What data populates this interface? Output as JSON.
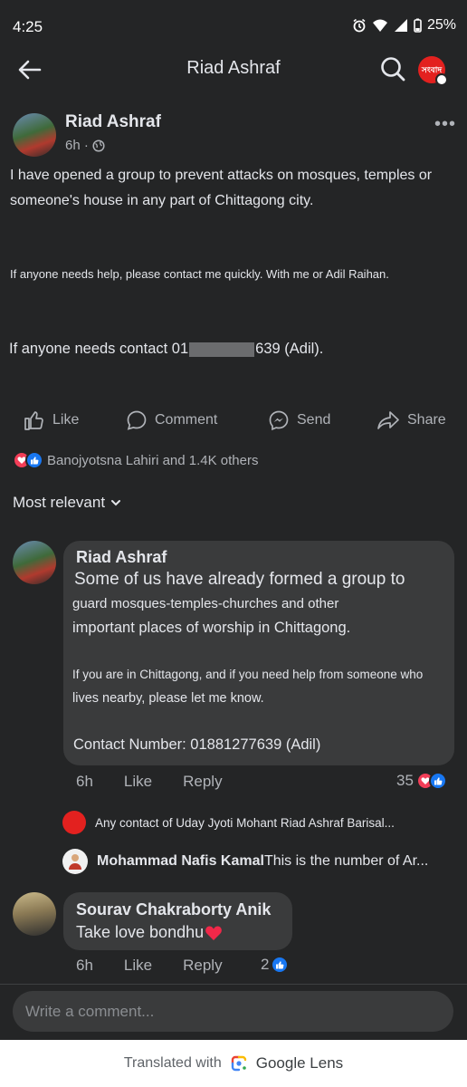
{
  "status_bar": {
    "time": "4:25",
    "battery": "25%"
  },
  "header": {
    "title": "Riad Ashraf",
    "avatar_text": "সংবাদ"
  },
  "post": {
    "author": "Riad Ashraf",
    "time": "6h ·",
    "text1": "I have opened a group to prevent attacks on mosques, temples or someone's house in any part of Chittagong city.",
    "text2": "If anyone needs help, please contact me quickly. With me or Adil Raihan.",
    "text3_before": "If anyone needs contact 01",
    "text3_after": "639 (Adil).",
    "actions": {
      "like": "Like",
      "comment": "Comment",
      "send": "Send",
      "share": "Share"
    },
    "reactions_text": "Banojyotsna Lahiri and 1.4K others",
    "sort_label": "Most relevant"
  },
  "comments": [
    {
      "name": "Riad Ashraf",
      "line1": "Some of us have already formed a group to",
      "line2": "guard mosques-temples-churches and other",
      "line3": "important places of worship in Chittagong.",
      "line4": "If you are in Chittagong, and if you need help from someone who",
      "line5": "lives nearby, please let me know.",
      "line6": "Contact Number: 01881277639 (Adil)",
      "time": "6h",
      "like": "Like",
      "reply": "Reply",
      "count": "35"
    },
    {
      "name": "Sourav Chakraborty Anik",
      "text": "Take love bondhu",
      "time": "6h",
      "like": "Like",
      "reply": "Reply",
      "count": "2"
    }
  ],
  "replies": [
    {
      "text": "Any contact of Uday Jyoti Mohant Riad Ashraf Barisal..."
    },
    {
      "name": "Mohammad Nafis Kamal",
      "text": " This is the number of Ar..."
    }
  ],
  "composer": {
    "placeholder": "Write a comment..."
  },
  "lens": {
    "prefix": "Translated with",
    "brand": "Google Lens"
  },
  "colors": {
    "background": "#242526",
    "bubble": "#3a3b3c",
    "like_blue": "#1877f2",
    "love_red": "#f33e58"
  }
}
